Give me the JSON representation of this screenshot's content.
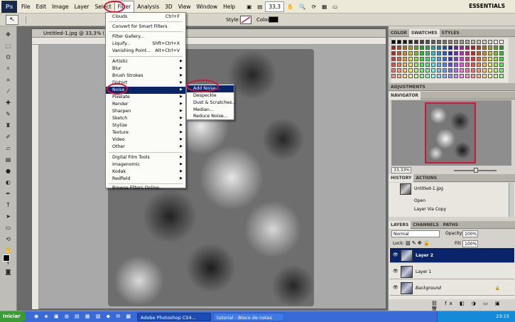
{
  "menubar": {
    "items": [
      "File",
      "Edit",
      "Image",
      "Layer",
      "Select",
      "Filter",
      "Analysis",
      "3D",
      "View",
      "Window",
      "Help"
    ],
    "zoom": "33,3",
    "workspace": "ESSENTIALS"
  },
  "options": {
    "style_label": "Style:",
    "color_label": "Color:"
  },
  "document": {
    "tab_title": "Untitled-1.jpg @ 33,3% (Lay"
  },
  "filter_menu": {
    "clouds": "Clouds",
    "clouds_shortcut": "Ctrl+F",
    "convert": "Convert for Smart Filters",
    "gallery": "Filter Gallery...",
    "liquify": "Liquify...",
    "liquify_shortcut": "Shft+Ctrl+X",
    "vanishing": "Vanishing Point...",
    "vanishing_shortcut": "Alt+Ctrl+V",
    "items": [
      "Artistic",
      "Blur",
      "Brush Strokes",
      "Distort",
      "Noise",
      "Pixelate",
      "Render",
      "Sharpen",
      "Sketch",
      "Stylize",
      "Texture",
      "Video",
      "Other"
    ],
    "items2": [
      "Digital Film Tools",
      "Imagenomic",
      "Kodak",
      "Redfield"
    ],
    "browse": "Browse Filters Online..."
  },
  "noise_submenu": [
    "Add Noise...",
    "Despeckle",
    "Dust & Scratches...",
    "Median...",
    "Reduce Noise..."
  ],
  "panels": {
    "color_tabs": [
      "COLOR",
      "SWATCHES",
      "STYLES"
    ],
    "adjustments": "ADJUSTMENTS",
    "navigator": "NAVIGATOR",
    "nav_zoom": "33,33%",
    "history_tabs": [
      "HISTORY",
      "ACTIONS"
    ],
    "history": [
      "Untitled-1.jpg",
      "Open",
      "Layer Via Copy"
    ],
    "layers_tabs": [
      "LAYERS",
      "CHANNELS",
      "PATHS"
    ],
    "blend": "Normal",
    "opacity_label": "Opacity:",
    "opacity": "100%",
    "lock_label": "Lock:",
    "fill_label": "Fill:",
    "fill": "100%",
    "layers": [
      "Layer 2",
      "Layer 1",
      "Background"
    ]
  },
  "taskbar": {
    "start": "Iniciar",
    "tasks": [
      "Adobe Photoshop CS4...",
      "tutorial - Bloco de notas"
    ],
    "time": "23:15"
  },
  "colors": {
    "highlight": "#0a246a",
    "annotation": "#d2163a"
  }
}
